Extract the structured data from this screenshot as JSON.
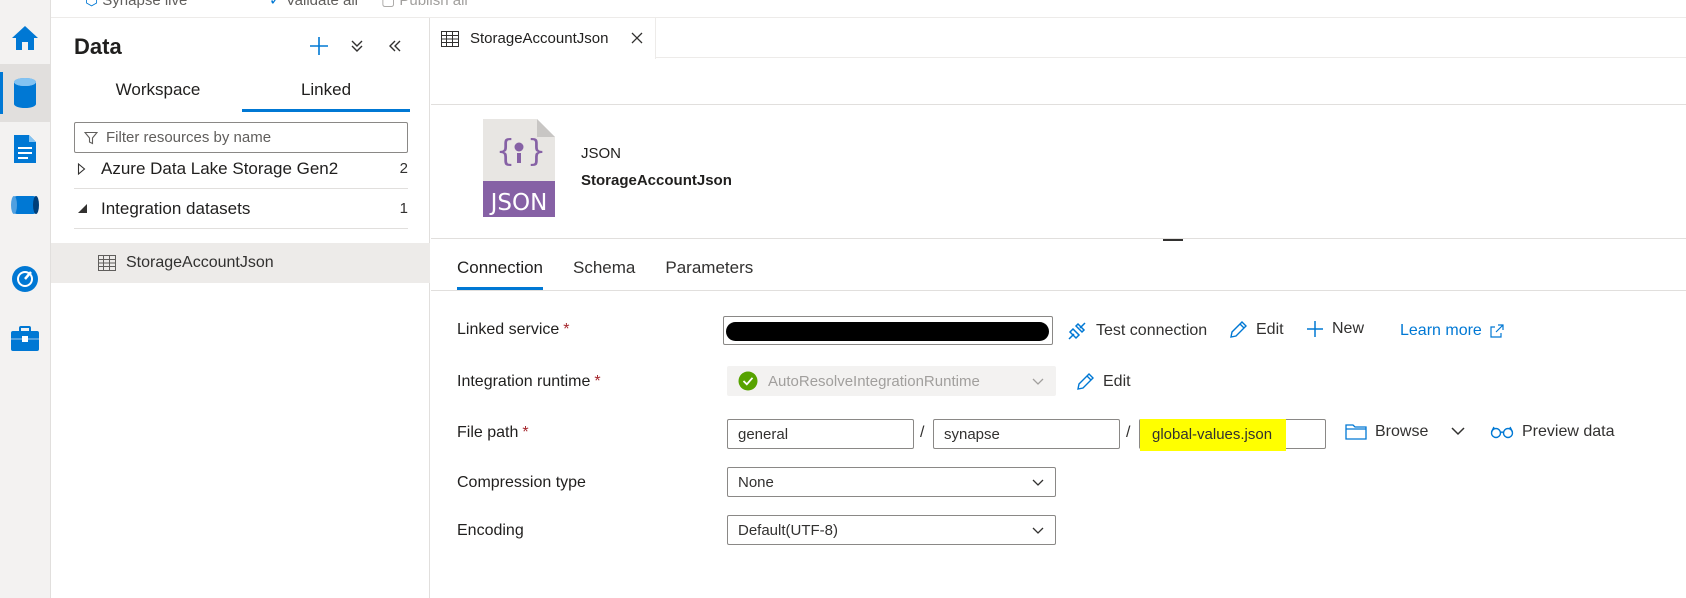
{
  "toolbar": {
    "workspace_label": "Synapse live",
    "validate_label": "Validate all",
    "publish_label": "Publish all"
  },
  "colors": {
    "accent": "#0078d4",
    "required": "#a4262c",
    "success": "#57a300",
    "json_icon": "#8661a5",
    "highlight": "#ffff00"
  },
  "rail": {
    "items": [
      {
        "name": "home",
        "icon": "home-icon"
      },
      {
        "name": "data",
        "icon": "database-icon",
        "active": true
      },
      {
        "name": "develop",
        "icon": "document-icon"
      },
      {
        "name": "integrate",
        "icon": "pipeline-icon"
      },
      {
        "name": "monitor",
        "icon": "monitor-icon"
      },
      {
        "name": "manage",
        "icon": "toolbox-icon"
      }
    ]
  },
  "panel": {
    "title": "Data",
    "tabs": [
      "Workspace",
      "Linked"
    ],
    "active_tab": "Linked",
    "filter_placeholder": "Filter resources by name",
    "tree": [
      {
        "label": "Azure Data Lake Storage Gen2",
        "count": "2",
        "expanded": false
      },
      {
        "label": "Integration datasets",
        "count": "1",
        "expanded": true
      }
    ],
    "selected_item": "StorageAccountJson"
  },
  "editor": {
    "tab_label": "StorageAccountJson",
    "dataset_type": "JSON",
    "dataset_name": "StorageAccountJson",
    "icon_text": "JSON",
    "tabs": [
      "Connection",
      "Schema",
      "Parameters"
    ],
    "active_tab": "Connection"
  },
  "form": {
    "linked_service": {
      "label": "Linked service",
      "required": "*",
      "test_connection": "Test connection",
      "edit": "Edit",
      "new": "New",
      "learn_more": "Learn more"
    },
    "integration_runtime": {
      "label": "Integration runtime",
      "required": "*",
      "value": "AutoResolveIntegrationRuntime",
      "edit": "Edit"
    },
    "file_path": {
      "label": "File path",
      "required": "*",
      "container": "general",
      "directory": "synapse",
      "file": "global-values.json",
      "separator": "/",
      "browse": "Browse",
      "preview": "Preview data"
    },
    "compression": {
      "label": "Compression type",
      "value": "None"
    },
    "encoding": {
      "label": "Encoding",
      "value": "Default(UTF-8)"
    }
  }
}
